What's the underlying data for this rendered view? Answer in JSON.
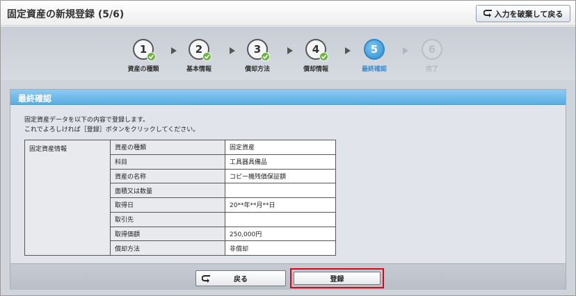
{
  "header": {
    "title": "固定資産の新規登録 (5/6)",
    "discard_label": "入力を破棄して戻る"
  },
  "steps": [
    {
      "number": "1",
      "label": "資産の種類",
      "state": "done"
    },
    {
      "number": "2",
      "label": "基本情報",
      "state": "done"
    },
    {
      "number": "3",
      "label": "償却方法",
      "state": "done"
    },
    {
      "number": "4",
      "label": "償却情報",
      "state": "done"
    },
    {
      "number": "5",
      "label": "最終確認",
      "state": "current"
    },
    {
      "number": "6",
      "label": "完了",
      "state": "future"
    }
  ],
  "panel": {
    "title": "最終確認",
    "intro_line1": "固定資産データを以下の内容で登録します。",
    "intro_line2": "これでよろしければ［登録］ボタンをクリックしてください。"
  },
  "table": {
    "group_label": "固定資産情報",
    "rows": [
      {
        "label": "資産の種類",
        "value": "固定資産"
      },
      {
        "label": "科目",
        "value": "工具器具備品"
      },
      {
        "label": "資産の名称",
        "value": "コピー機残価保証額"
      },
      {
        "label": "面積又は数量",
        "value": ""
      },
      {
        "label": "取得日",
        "value": "20**年**月**日"
      },
      {
        "label": "取引先",
        "value": ""
      },
      {
        "label": "取得価額",
        "value": "250,000円"
      },
      {
        "label": "償却方法",
        "value": "非償却"
      }
    ]
  },
  "footer": {
    "back_label": "戻る",
    "register_label": "登録"
  },
  "colors": {
    "accent": "#57aee3",
    "check": "#6db33f",
    "highlight": "#e0001a"
  }
}
